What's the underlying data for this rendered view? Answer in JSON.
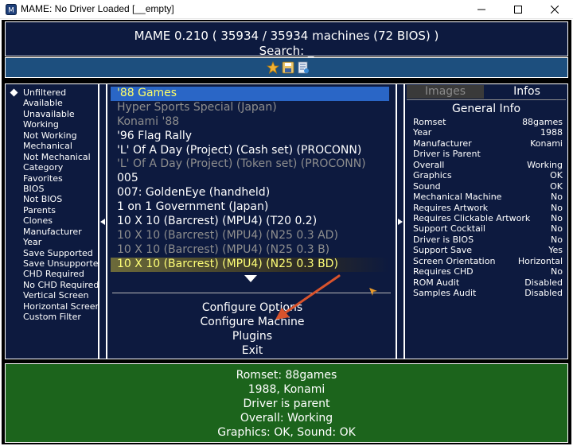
{
  "window": {
    "title": "MAME: No Driver Loaded [__empty]"
  },
  "header": {
    "title": "MAME 0.210 ( 35934 / 35934 machines (72 BIOS) )",
    "search": "Search: _"
  },
  "toolbar": {
    "icons": [
      "star-icon",
      "save-icon",
      "document-icon"
    ]
  },
  "filters": [
    "Unfiltered",
    "Available",
    "Unavailable",
    "Working",
    "Not Working",
    "Mechanical",
    "Not Mechanical",
    "Category",
    "Favorites",
    "BIOS",
    "Not BIOS",
    "Parents",
    "Clones",
    "Manufacturer",
    "Year",
    "Save Supported",
    "Save Unsupported",
    "CHD Required",
    "No CHD Required",
    "Vertical Screen",
    "Horizontal Screen",
    "Custom Filter"
  ],
  "games": [
    "'88 Games",
    "Hyper Sports Special (Japan)",
    "Konami '88",
    "'96 Flag Rally",
    "'L' Of A Day (Project) (Cash set) (PROCONN)",
    "'L' Of A Day (Project) (Token set) (PROCONN)",
    "005",
    "007: GoldenEye (handheld)",
    "1 on 1 Government (Japan)",
    "10 X 10 (Barcrest) (MPU4) (T20 0.2)",
    "10 X 10 (Barcrest) (MPU4) (N25 0.3 AD)",
    "10 X 10 (Barcrest) (MPU4) (N25 0.3 B)",
    "10 X 10 (Barcrest) (MPU4) (N25 0.3 BD)"
  ],
  "menu": [
    "Configure Options",
    "Configure Machine",
    "Plugins",
    "Exit"
  ],
  "tabs": {
    "images": "Images",
    "infos": "Infos"
  },
  "info": {
    "heading": "General Info",
    "rows": [
      {
        "label": "Romset",
        "value": "88games"
      },
      {
        "label": "Year",
        "value": "1988"
      },
      {
        "label": "Manufacturer",
        "value": "Konami"
      },
      {
        "label": "Driver is Parent",
        "value": ""
      },
      {
        "label": "Overall",
        "value": "Working"
      },
      {
        "label": "Graphics",
        "value": "OK"
      },
      {
        "label": "Sound",
        "value": "OK"
      },
      {
        "label": "Mechanical Machine",
        "value": "No"
      },
      {
        "label": "Requires Artwork",
        "value": "No"
      },
      {
        "label": "Requires Clickable Artwork",
        "value": "No"
      },
      {
        "label": "Support Cocktail",
        "value": "No"
      },
      {
        "label": "Driver is BIOS",
        "value": "No"
      },
      {
        "label": "Support Save",
        "value": "Yes"
      },
      {
        "label": "Screen Orientation",
        "value": "Horizontal"
      },
      {
        "label": "Requires CHD",
        "value": "No"
      },
      {
        "label": "ROM Audit",
        "value": "Disabled"
      },
      {
        "label": "Samples Audit",
        "value": "Disabled"
      }
    ]
  },
  "footer": {
    "lines": [
      "Romset: 88games",
      "1988, Konami",
      "Driver is parent",
      "Overall: Working",
      "Graphics: OK, Sound: OK"
    ]
  },
  "colors": {
    "panel_bg": "#0d1a3f",
    "toolbar_bg": "#1d4f7e",
    "footer_bg": "#1c641c",
    "selected_bg": "#2a66c6",
    "selected_text": "#ffff66",
    "clone_text": "#8e8e8e",
    "annotation": "#d9532c"
  }
}
